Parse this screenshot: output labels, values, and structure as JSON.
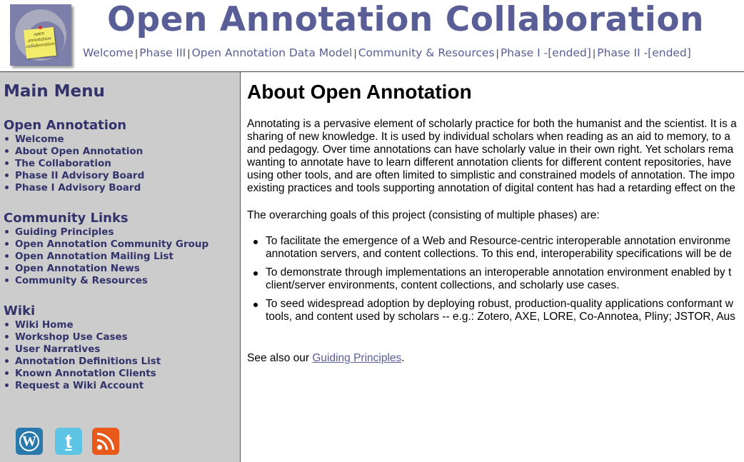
{
  "header": {
    "title": "Open Annotation Collaboration",
    "logo_text": "open annotation collaboration",
    "nav": [
      "Welcome",
      "Phase III",
      "Open Annotation Data Model",
      "Community & Resources",
      "Phase I -[ended]",
      "Phase II -[ended]"
    ]
  },
  "sidebar": {
    "menu_title": "Main Menu",
    "sections": [
      {
        "heading": "Open Annotation",
        "items": [
          "Welcome",
          "About Open Annotation",
          "The Collaboration",
          "Phase II Advisory Board",
          "Phase I Advisory Board"
        ]
      },
      {
        "heading": "Community Links",
        "items": [
          "Guiding Principles",
          "Open Annotation Community Group",
          "Open Annotation Mailing List",
          "Open Annotation News",
          "Community & Resources"
        ]
      },
      {
        "heading": "Wiki",
        "items": [
          "Wiki Home",
          "Workshop Use Cases",
          "User Narratives",
          "Annotation Definitions List",
          "Known Annotation Clients",
          "Request a Wiki Account"
        ]
      }
    ],
    "social": [
      "wordpress-icon",
      "twitter-icon",
      "rss-icon"
    ]
  },
  "main": {
    "heading": "About Open Annotation",
    "intro_lines": [
      "Annotating is a pervasive element of scholarly practice for both the humanist and the scientist. It is a",
      "sharing of new knowledge. It is used by individual scholars when reading as an aid to memory, to a",
      "and pedagogy. Over time annotations can have scholarly value in their own right. Yet scholars rema",
      "wanting to annotate have to learn different annotation clients for different content repositories, have",
      "using other tools, and are often limited to simplistic and constrained models of annotation. The impo",
      "existing practices and tools supporting annotation of digital content has had a retarding effect on the"
    ],
    "goals_intro": "The overarching goals of this project (consisting of multiple phases) are:",
    "goals": [
      [
        "To facilitate the emergence of a Web and Resource-centric interoperable annotation environme",
        "annotation servers, and content collections. To this end, interoperability specifications will be de"
      ],
      [
        "To demonstrate through implementations an interoperable annotation environment enabled by t",
        "client/server environments, content collections, and scholarly use cases."
      ],
      [
        "To seed widespread adoption by deploying robust, production-quality applications conformant w",
        "tools, and content used by scholars -- e.g.: Zotero, AXE, LORE, Co-Annotea, Pliny; JSTOR, Aus"
      ]
    ],
    "see_also_prefix": "See also our ",
    "see_also_link": "Guiding Principles",
    "see_also_suffix": "."
  },
  "colors": {
    "brand": "#5a5e97",
    "sidebar_bg": "#cccccc",
    "sidebar_text": "#33336b"
  }
}
